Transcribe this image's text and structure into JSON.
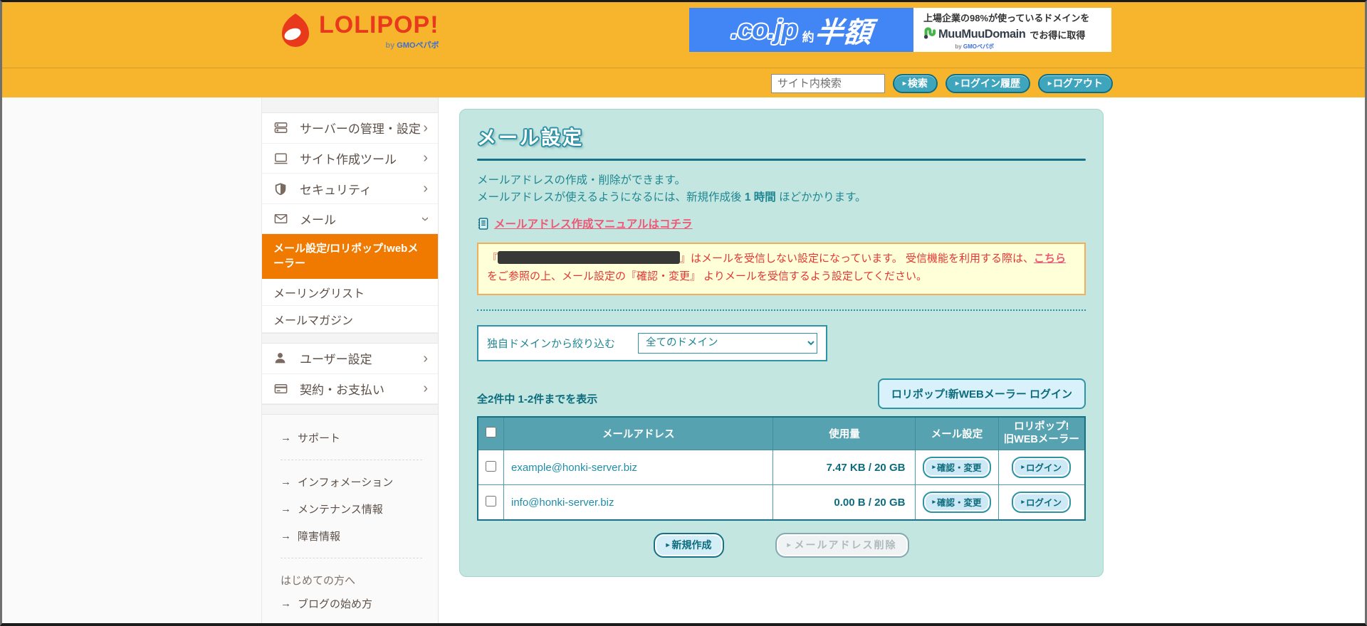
{
  "ui": {
    "arrow_glyph": "▸",
    "chevron_glyph": "›",
    "link_arrow_glyph": "→"
  },
  "header": {
    "logo": {
      "text": "LOLIPOP!",
      "by_prefix": "by ",
      "by_brand": "GMOペパボ"
    },
    "banner": {
      "cojp": ".co.jp",
      "yaku": "約",
      "hangaku": "半額",
      "line1": "上場企業の98%が使っているドメインを",
      "brand": "MuuMuuDomain",
      "brand_by_prefix": "by ",
      "brand_by": "GMOペパボ",
      "suffix": "でお得に取得"
    },
    "search": {
      "placeholder": "サイト内検索",
      "search_label": "検索",
      "history_label": "ログイン履歴",
      "logout_label": "ログアウト"
    }
  },
  "sidebar": {
    "nav": [
      {
        "label": "サーバーの管理・設定"
      },
      {
        "label": "サイト作成ツール"
      },
      {
        "label": "セキュリティ"
      },
      {
        "label": "メール"
      }
    ],
    "active": "メール設定/ロリポップ!webメーラー",
    "sub": [
      "メーリングリスト",
      "メールマガジン"
    ],
    "nav2": [
      {
        "label": "ユーザー設定"
      },
      {
        "label": "契約・お支払い"
      }
    ],
    "support": "サポート",
    "info_links": [
      "インフォメーション",
      "メンテナンス情報",
      "障害情報"
    ],
    "beginner_heading": "はじめての方へ",
    "beginner_link": "ブログの始め方"
  },
  "main": {
    "title": "メール設定",
    "desc1": "メールアドレスの作成・削除ができます。",
    "desc2_pre": "メールアドレスが使えるようになるには、新規作成後 ",
    "desc2_bold": "1 時間",
    "desc2_post": " ほどかかります。",
    "manual_link": "メールアドレス作成マニュアルはコチラ",
    "notice": {
      "quote_open": "『",
      "quote_close": "』",
      "text1": "はメールを受信しない設定になっています。 受信機能を利用する際は、",
      "link": "こちら",
      "text2": "をご参照の上、メール設定の『確認・変更』 よりメールを受信するよう設定してください。"
    },
    "filter": {
      "label": "独自ドメインから絞り込む",
      "selected": "全てのドメイン"
    },
    "count_text": "全2件中 1-2件までを表示",
    "webmail_button": "ロリポップ!新WEBメーラー ログイン",
    "table": {
      "header_email": "メールアドレス",
      "header_usage": "使用量",
      "header_setting": "メール設定",
      "header_old_webmailer": "ロリポップ!\n旧WEBメーラー",
      "rows": [
        {
          "email": "example@honki-server.biz",
          "usage": "7.47 KB / 20 GB",
          "setting_button": "確認・変更",
          "login_button": "ログイン"
        },
        {
          "email": "info@honki-server.biz",
          "usage": "0.00 B / 20 GB",
          "setting_button": "確認・変更",
          "login_button": "ログイン"
        }
      ]
    },
    "create_button": "新規作成",
    "delete_button": "メールアドレス削除"
  }
}
